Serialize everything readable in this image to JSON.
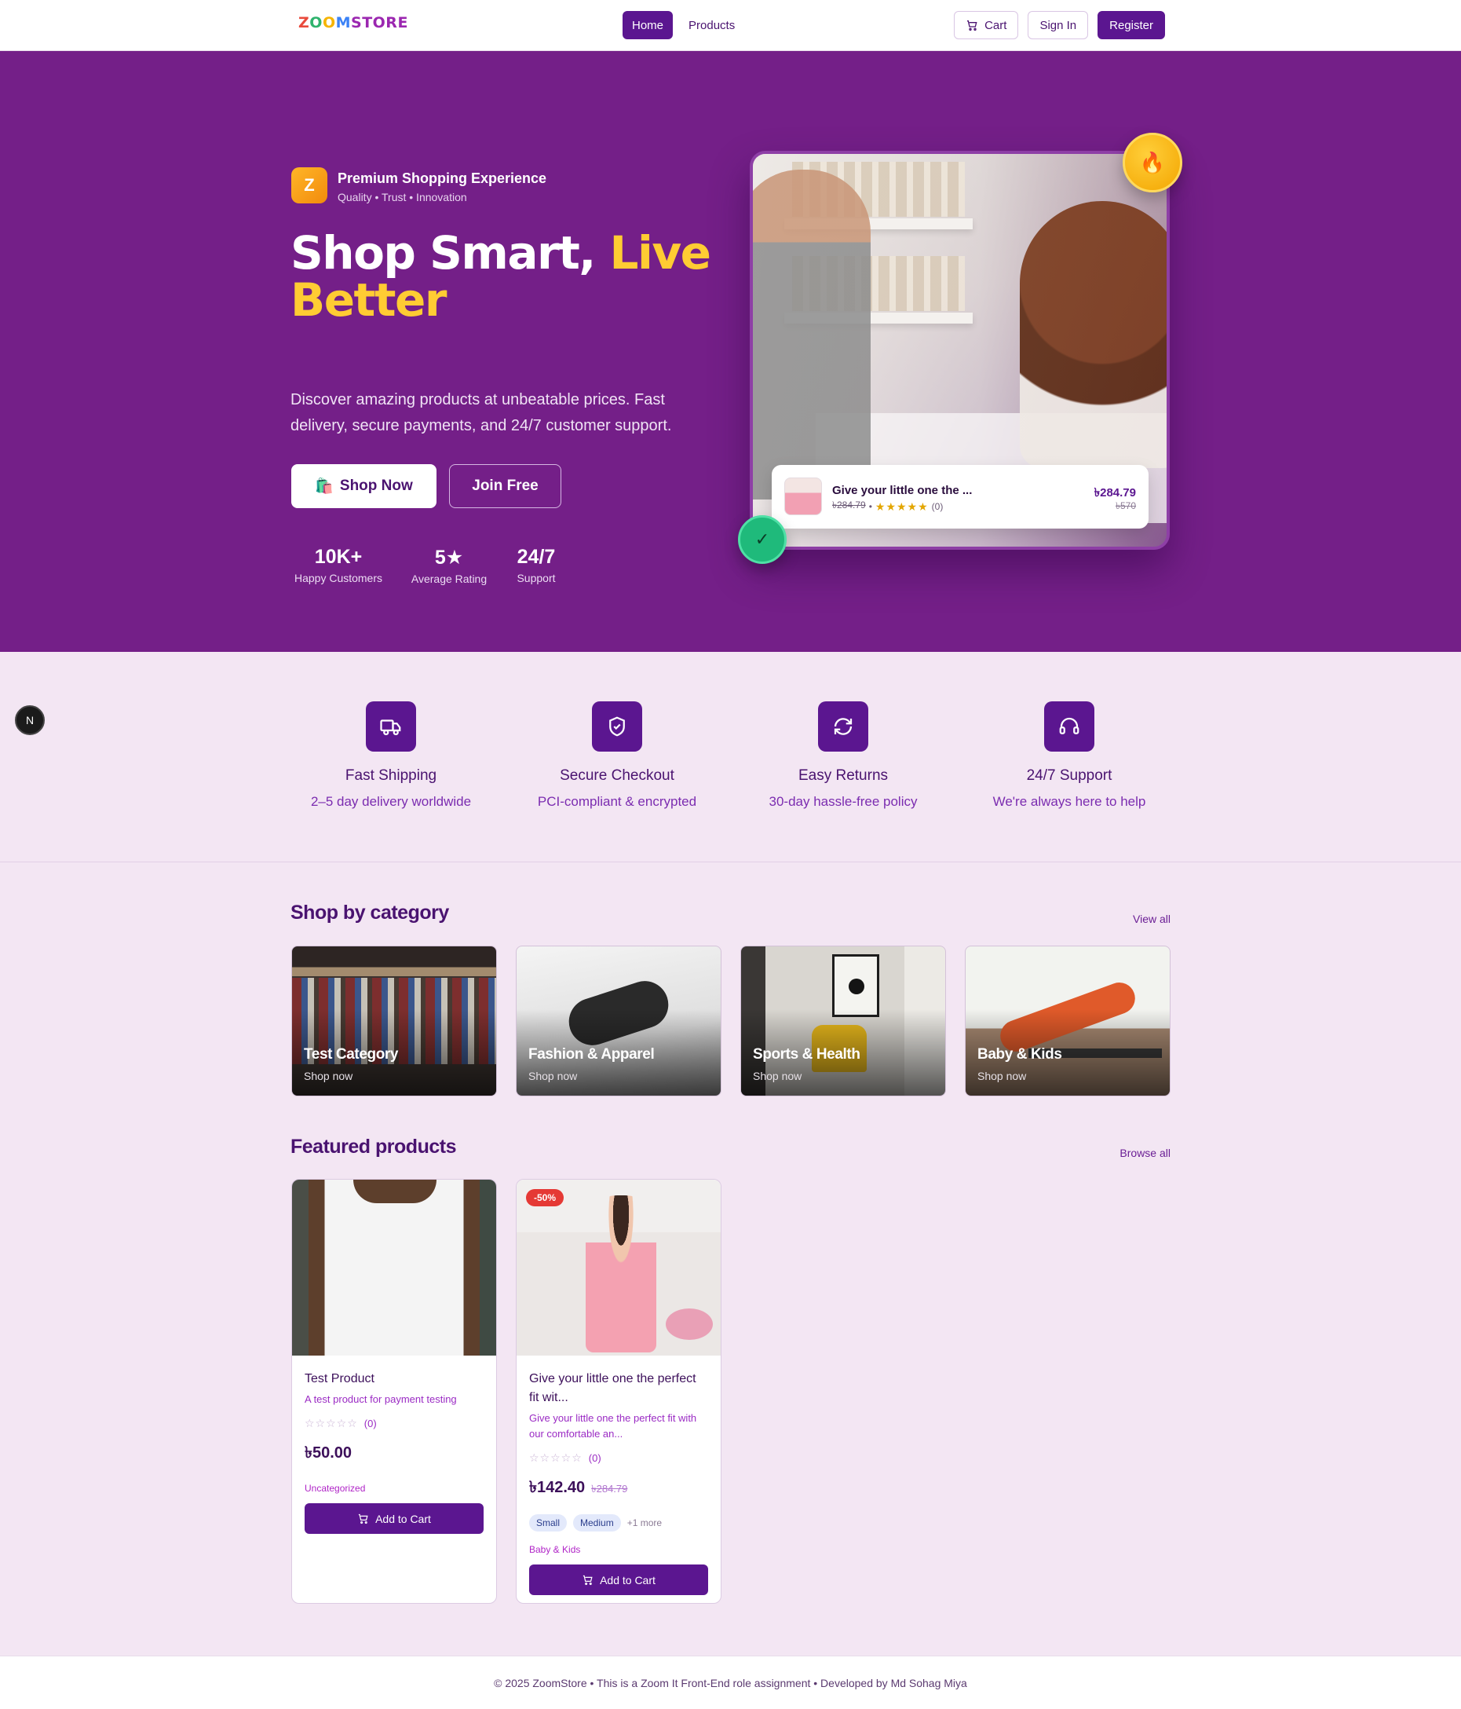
{
  "nav": {
    "logo_letters": [
      "Z",
      "O",
      "O",
      "M",
      "STORE"
    ],
    "links": [
      {
        "label": "Home",
        "active": true
      },
      {
        "label": "Products",
        "active": false
      }
    ],
    "cart_label": "Cart",
    "signin_label": "Sign In",
    "register_label": "Register"
  },
  "hero": {
    "badge_letter": "Z",
    "badge_title": "Premium Shopping Experience",
    "badge_sub": "Quality • Trust • Innovation",
    "headline_white": "Shop Smart, ",
    "headline_yellow": "Live Better",
    "paragraph": "Discover amazing products at unbeatable prices. Fast delivery, secure payments, and 24/7 customer support.",
    "shop_now_label": "Shop Now",
    "shop_now_emoji": "🛍️",
    "join_label": "Join Free",
    "stats": [
      {
        "num": "10K+",
        "label": "Happy Customers"
      },
      {
        "num": "5★",
        "label": "Average Rating"
      },
      {
        "num": "24/7",
        "label": "Support"
      }
    ],
    "card": {
      "product_title": "Give your little one the ...",
      "meta_price": "৳284.79",
      "meta_sep": "•",
      "stars": "★★★★★",
      "reviews": "(0)",
      "price": "৳284.79",
      "old_price": "৳570"
    },
    "fire_icon": "🔥",
    "check_icon": "✓"
  },
  "features": [
    {
      "title": "Fast Shipping",
      "sub": "2–5 day delivery worldwide",
      "icon": "truck-icon"
    },
    {
      "title": "Secure Checkout",
      "sub": "PCI-compliant & encrypted",
      "icon": "shield-icon"
    },
    {
      "title": "Easy Returns",
      "sub": "30-day hassle-free policy",
      "icon": "refresh-icon"
    },
    {
      "title": "24/7 Support",
      "sub": "We're always here to help",
      "icon": "headset-icon"
    }
  ],
  "n_badge": "N",
  "categories": {
    "title": "Shop by category",
    "link": "View all",
    "items": [
      {
        "name": "Test Category",
        "cta": "Shop now"
      },
      {
        "name": "Fashion & Apparel",
        "cta": "Shop now"
      },
      {
        "name": "Sports & Health",
        "cta": "Shop now"
      },
      {
        "name": "Baby & Kids",
        "cta": "Shop now"
      }
    ]
  },
  "products": {
    "title": "Featured products",
    "link": "Browse all",
    "items": [
      {
        "title": "Test Product",
        "desc": "A test product for payment testing",
        "stars": "☆☆☆☆☆",
        "reviews": "(0)",
        "price": "৳50.00",
        "category": "Uncategorized",
        "button": "Add to Cart"
      },
      {
        "sale": "-50%",
        "title": "Give your little one the perfect fit wit...",
        "desc": "Give your little one the perfect fit with our comfortable an...",
        "stars": "☆☆☆☆☆",
        "reviews": "(0)",
        "price": "৳142.40",
        "old_price": "৳284.79",
        "sizes": [
          "Small",
          "Medium"
        ],
        "more": "+1 more",
        "category": "Baby & Kids",
        "button": "Add to Cart"
      }
    ]
  },
  "footer": {
    "text": "© 2025 ZoomStore • This is a Zoom It Front-End role assignment • Developed by Md Sohag Miya"
  },
  "colors": {
    "brand": "#5b1690",
    "hero_bg": "#741f88",
    "page_bg": "#f3e6f3",
    "accent_yellow": "#ffcc33",
    "sale_red": "#e53935"
  }
}
